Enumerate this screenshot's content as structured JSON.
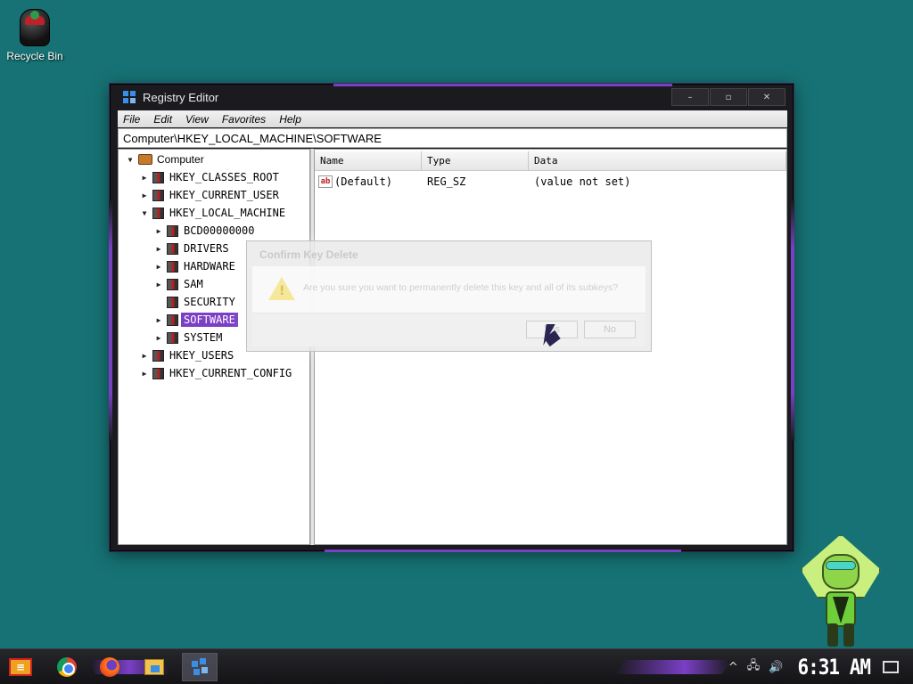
{
  "desktop": {
    "icons": [
      {
        "label": "Recycle Bin",
        "icon": "recycle-bin-icon"
      }
    ]
  },
  "window": {
    "title": "Registry Editor",
    "controls": {
      "minimize": "–",
      "maximize": "▫",
      "close": "✕"
    },
    "menu": [
      "File",
      "Edit",
      "View",
      "Favorites",
      "Help"
    ],
    "address": "Computer\\HKEY_LOCAL_MACHINE\\SOFTWARE",
    "tree": {
      "root": "Computer",
      "hives": [
        {
          "label": "HKEY_CLASSES_ROOT",
          "expanded": false
        },
        {
          "label": "HKEY_CURRENT_USER",
          "expanded": false
        },
        {
          "label": "HKEY_LOCAL_MACHINE",
          "expanded": true,
          "children": [
            "BCD00000000",
            "DRIVERS",
            "HARDWARE",
            "SAM",
            "SECURITY",
            "SOFTWARE",
            "SYSTEM"
          ],
          "selected": "SOFTWARE"
        },
        {
          "label": "HKEY_USERS",
          "expanded": false
        },
        {
          "label": "HKEY_CURRENT_CONFIG",
          "expanded": false
        }
      ]
    },
    "list": {
      "columns": [
        "Name",
        "Type",
        "Data"
      ],
      "rows": [
        {
          "name": "(Default)",
          "type": "REG_SZ",
          "data": "(value not set)",
          "icon": "string-value-icon"
        }
      ]
    }
  },
  "dialog": {
    "title": "Confirm Key Delete",
    "message": "Are you sure you want to permanently delete this key and all of its subkeys?",
    "buttons": {
      "yes": "Yes",
      "no": "No"
    },
    "icon": "warning-icon"
  },
  "taskbar": {
    "apps": [
      "start-icon",
      "chrome-icon",
      "firefox-icon",
      "file-explorer-icon",
      "registry-editor-icon"
    ],
    "tray": {
      "chevron": "^",
      "clock": "6:31 AM"
    }
  },
  "colors": {
    "desktop": "#167274",
    "accent": "#7b3fc6",
    "window": "#1b1b1f"
  }
}
